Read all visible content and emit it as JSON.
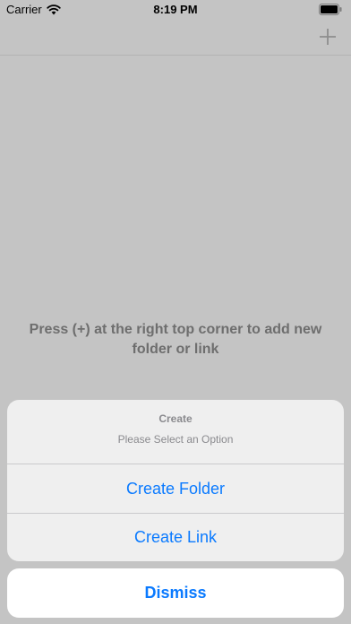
{
  "status_bar": {
    "carrier": "Carrier",
    "time": "8:19 PM",
    "wifi_icon": "wifi-icon",
    "battery_icon": "battery-icon"
  },
  "nav": {
    "add_icon": "plus-icon"
  },
  "empty_state": {
    "message": "Press (+) at the right top corner to add new folder or link"
  },
  "action_sheet": {
    "title": "Create",
    "message": "Please Select an Option",
    "actions": [
      {
        "label": "Create Folder"
      },
      {
        "label": "Create Link"
      }
    ],
    "cancel_label": "Dismiss"
  },
  "colors": {
    "accent": "#0a7aff",
    "dimmed_background": "#c4c4c4",
    "sheet_background": "#efefef",
    "secondary_text": "#8a8a8e"
  }
}
